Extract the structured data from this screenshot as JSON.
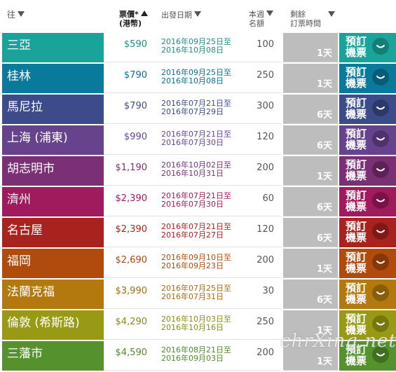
{
  "header": {
    "destination": "往",
    "price_line1": "票價*",
    "price_line2": "(港幣)",
    "departure": "出發日期",
    "quota_line1": "本週",
    "quota_line2": "名額",
    "remaining_line1": "剩餘",
    "remaining_line2": "訂票時間"
  },
  "book_label_line1": "預訂",
  "book_label_line2": "機票",
  "rows": [
    {
      "dest": "三亞",
      "price": "$590",
      "date1": "2016年09月25日至",
      "date2": "2016年10月08日",
      "quota": "100",
      "remain": "1天",
      "color": "#1aa39a",
      "btn": "#137f77",
      "accent": "#1a8f87"
    },
    {
      "dest": "桂林",
      "price": "$790",
      "date1": "2016年09月25日至",
      "date2": "2016年10月08日",
      "quota": "250",
      "remain": "1天",
      "color": "#0a7a9c",
      "btn": "#075d77",
      "accent": "#0a6f8f"
    },
    {
      "dest": "馬尼拉",
      "price": "$790",
      "date1": "2016年07月21日至",
      "date2": "2016年07月29日",
      "quota": "300",
      "remain": "6天",
      "color": "#3c4b8a",
      "btn": "#2c3868",
      "accent": "#3c4b8a"
    },
    {
      "dest": "上海 (浦東)",
      "price": "$990",
      "date1": "2016年07月21日至",
      "date2": "2016年07月30日",
      "quota": "120",
      "remain": "6天",
      "color": "#67438e",
      "btn": "#4e316d",
      "accent": "#67438e"
    },
    {
      "dest": "胡志明市",
      "price": "$1,190",
      "date1": "2016年10月02日至",
      "date2": "2016年10月31日",
      "quota": "200",
      "remain": "1天",
      "color": "#7b2f75",
      "btn": "#5c2258",
      "accent": "#7b2f75"
    },
    {
      "dest": "濟州",
      "price": "$2,390",
      "date1": "2016年07月21日至",
      "date2": "2016年07月30日",
      "quota": "60",
      "remain": "6天",
      "color": "#a01a5e",
      "btn": "#7a1247",
      "accent": "#a01a5e"
    },
    {
      "dest": "名古屋",
      "price": "$2,390",
      "date1": "2016年07月21日至",
      "date2": "2016年07月27日",
      "quota": "120",
      "remain": "6天",
      "color": "#a8231e",
      "btn": "#801915",
      "accent": "#a8231e"
    },
    {
      "dest": "福岡",
      "price": "$2,690",
      "date1": "2016年09月10日至",
      "date2": "2016年09月23日",
      "quota": "200",
      "remain": "1天",
      "color": "#b04a0d",
      "btn": "#883808",
      "accent": "#b04a0d"
    },
    {
      "dest": "法蘭克福",
      "price": "$3,990",
      "date1": "2016年07月25日至",
      "date2": "2016年07月31日",
      "quota": "30",
      "remain": "6天",
      "color": "#b3790e",
      "btn": "#8a5d09",
      "accent": "#a36d0c"
    },
    {
      "dest": "倫敦 (希斯路)",
      "price": "$4,290",
      "date1": "2016年10月03日至",
      "date2": "2016年10月16日",
      "quota": "250",
      "remain": "1天",
      "color": "#999a14",
      "btn": "#76770d",
      "accent": "#8a8b12"
    },
    {
      "dest": "三藩市",
      "price": "$4,590",
      "date1": "2016年08月21日至",
      "date2": "2016年09月03日",
      "quota": "200",
      "remain": "1天",
      "color": "#55922e",
      "btn": "#3f6f21",
      "accent": "#4f8a2a"
    }
  ],
  "watermark": "chrXing.net"
}
